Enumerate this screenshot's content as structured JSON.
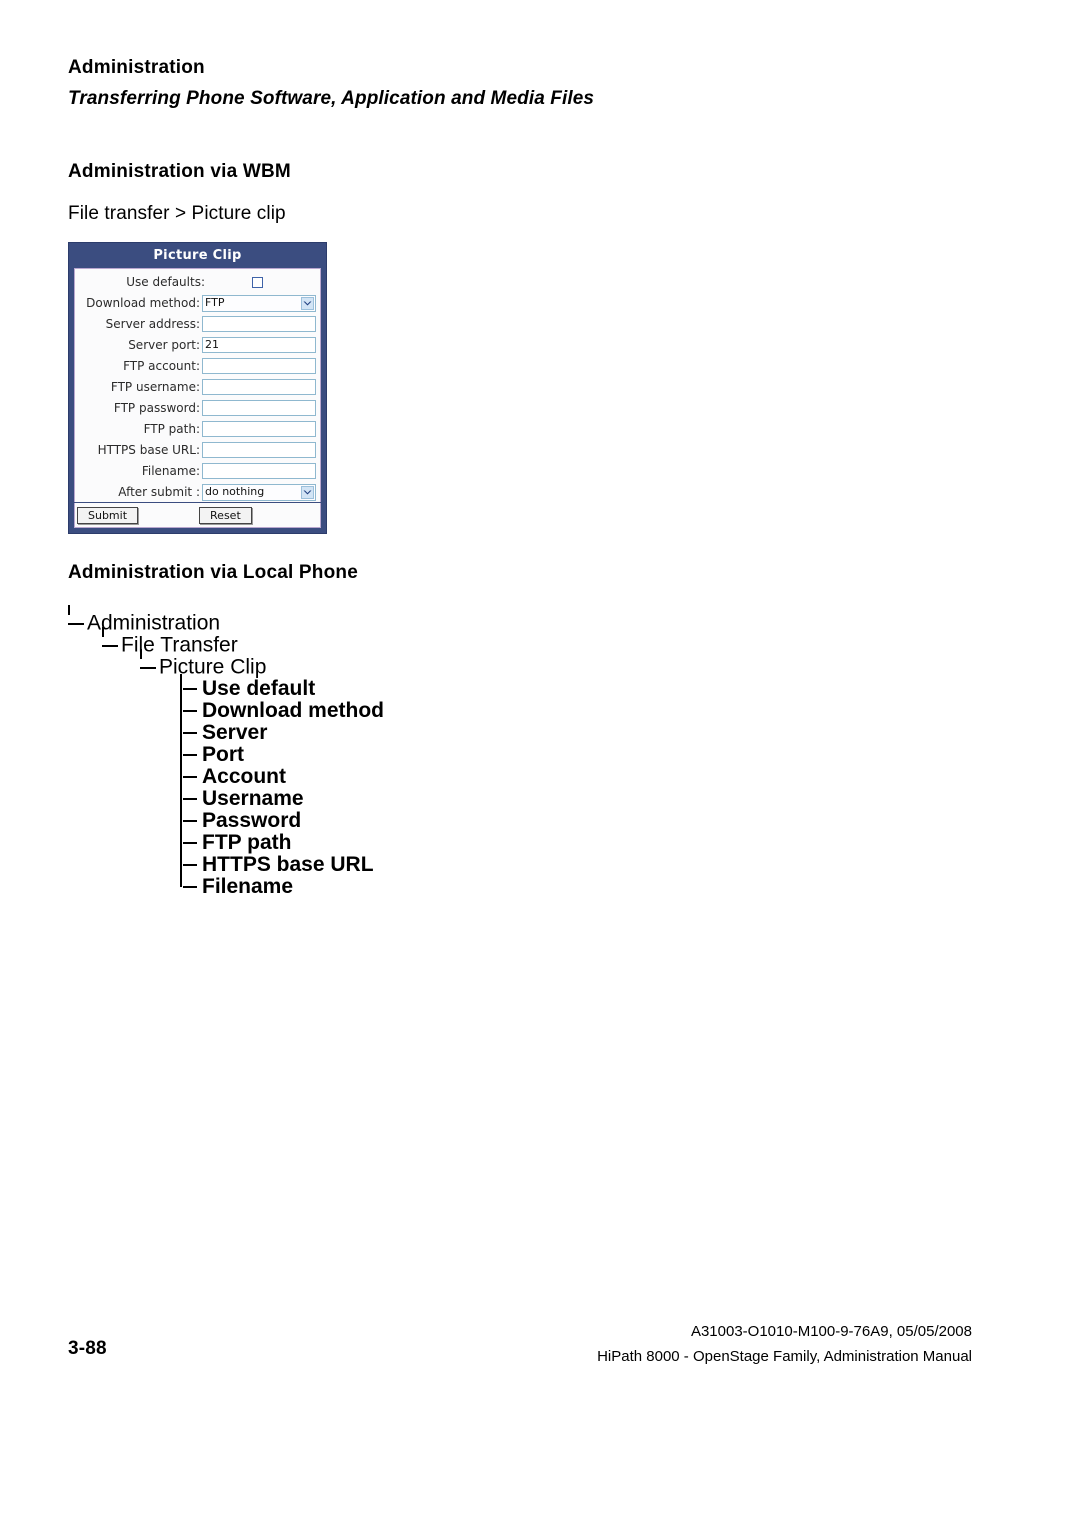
{
  "running_head": {
    "title": "Administration",
    "subtitle": "Transferring Phone Software, Application and Media Files"
  },
  "sections": {
    "wbm_heading": "Administration via WBM",
    "wbm_path": "File transfer > Picture clip",
    "local_phone_heading": "Administration via Local Phone"
  },
  "wbm_form": {
    "title": "Picture Clip",
    "rows": [
      {
        "label": "Use defaults:",
        "type": "checkbox",
        "value": ""
      },
      {
        "label": "Download method:",
        "type": "select",
        "value": "FTP"
      },
      {
        "label": "Server address:",
        "type": "text",
        "value": ""
      },
      {
        "label": "Server port:",
        "type": "text",
        "value": "21"
      },
      {
        "label": "FTP account:",
        "type": "text",
        "value": ""
      },
      {
        "label": "FTP username:",
        "type": "text",
        "value": ""
      },
      {
        "label": "FTP password:",
        "type": "text",
        "value": ""
      },
      {
        "label": "FTP path:",
        "type": "text",
        "value": ""
      },
      {
        "label": "HTTPS base URL:",
        "type": "text",
        "value": ""
      },
      {
        "label": "Filename:",
        "type": "text",
        "value": ""
      },
      {
        "label": "After submit :",
        "type": "select",
        "value": "do nothing"
      }
    ],
    "submit_label": "Submit",
    "reset_label": "Reset",
    "header_color": "#3b4d80",
    "body_color": "#fbfbfc"
  },
  "tree": {
    "branches": [
      {
        "label": "Administration"
      },
      {
        "label": "File Transfer"
      },
      {
        "label": "Picture Clip"
      }
    ],
    "leaves": [
      {
        "label": "Use default"
      },
      {
        "label": "Download method"
      },
      {
        "label": "Server"
      },
      {
        "label": "Port"
      },
      {
        "label": "Account"
      },
      {
        "label": "Username"
      },
      {
        "label": "Password"
      },
      {
        "label": "FTP path"
      },
      {
        "label": "HTTPS base URL"
      },
      {
        "label": "Filename"
      }
    ]
  },
  "footer": {
    "page_number": "3-88",
    "doc_id": "A31003-O1010-M100-9-76A9, 05/05/2008",
    "doc_title": "HiPath 8000 - OpenStage Family, Administration Manual"
  }
}
